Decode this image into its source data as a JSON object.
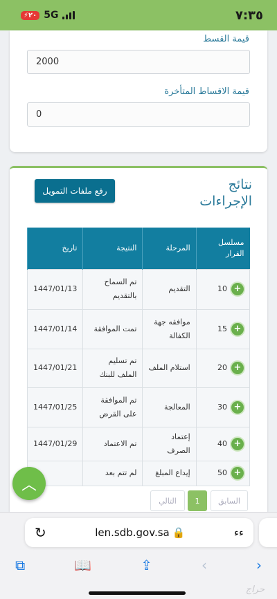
{
  "status_bar": {
    "time": "٧:٣٥",
    "network": "5G",
    "battery": "٢٠"
  },
  "form": {
    "installment_label": "قيمة القسط",
    "installment_value": "2000",
    "late_label": "قيمة الاقساط المتأخرة",
    "late_value": "0"
  },
  "results": {
    "title": "نتائج الإجراءات",
    "files_button": "رفع ملفات التمويل",
    "headers": {
      "serial": "مسلسل القرار",
      "stage": "المرحلة",
      "result": "النتيجة",
      "date": "تاريخ"
    },
    "rows": [
      {
        "serial": "10",
        "stage": "التقديم",
        "result": "تم السماح بالتقديم",
        "date": "1447/01/13"
      },
      {
        "serial": "15",
        "stage": "موافقه جهة الكفالة",
        "result": "تمت الموافقة",
        "date": "1447/01/14"
      },
      {
        "serial": "20",
        "stage": "استلام الملف",
        "result": "تم تسليم الملف للبنك",
        "date": "1447/01/21"
      },
      {
        "serial": "30",
        "stage": "المعالجة",
        "result": "تم الموافقة على القرض",
        "date": "1447/01/25"
      },
      {
        "serial": "40",
        "stage": "إعتماد الصرف",
        "result": "تم الاعتماد",
        "date": "1447/01/29"
      },
      {
        "serial": "50",
        "stage": "إيداع المبلغ",
        "result": "لم تتم بعد",
        "date": ""
      }
    ],
    "pagination": {
      "prev": "السابق",
      "current": "1",
      "next": "التالي"
    }
  },
  "browser": {
    "url": "len.sdb.gov.sa",
    "text_size": "ءء"
  },
  "watermark": "حراج"
}
